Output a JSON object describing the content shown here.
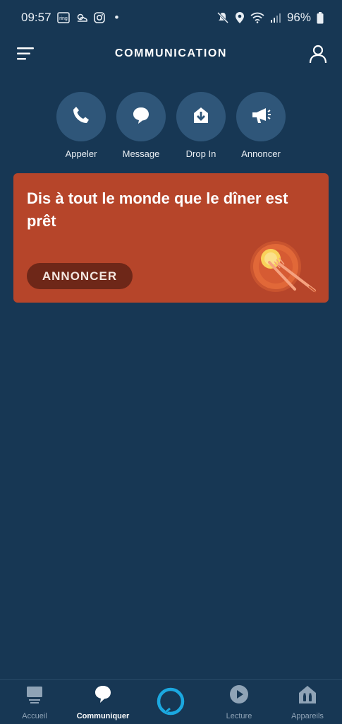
{
  "status_bar": {
    "time": "09:57",
    "dot": "•",
    "battery": "96%",
    "icons_left": [
      "ring-icon",
      "weather-icon",
      "instagram-icon"
    ],
    "icons_right": [
      "mute-icon",
      "location-icon",
      "wifi-icon",
      "signal-icon",
      "battery-icon"
    ]
  },
  "header": {
    "title": "COMMUNICATION",
    "menu_icon": "hamburger-menu-icon",
    "profile_icon": "profile-icon"
  },
  "actions": [
    {
      "label": "Appeler",
      "icon": "phone-icon"
    },
    {
      "label": "Message",
      "icon": "chat-bubble-icon"
    },
    {
      "label": "Drop In",
      "icon": "drop-in-icon"
    },
    {
      "label": "Annoncer",
      "icon": "megaphone-icon"
    }
  ],
  "card": {
    "title": "Dis à tout le monde que le dîner est prêt",
    "button_label": "ANNONCER",
    "illustration": "dinner-plate-illustration"
  },
  "bottom_nav": {
    "items": [
      {
        "label": "Accueil",
        "icon": "home-icon",
        "active": false
      },
      {
        "label": "Communiquer",
        "icon": "chat-icon",
        "active": true
      },
      {
        "label": "Lecture",
        "icon": "play-icon",
        "active": false
      },
      {
        "label": "Appareils",
        "icon": "devices-icon",
        "active": false
      }
    ],
    "center_icon": "alexa-icon"
  },
  "colors": {
    "background": "#173754",
    "action_circle": "#2f5679",
    "card": "#b6452a",
    "card_button": "#6e2718",
    "alexa_ring": "#1ba8e0"
  }
}
